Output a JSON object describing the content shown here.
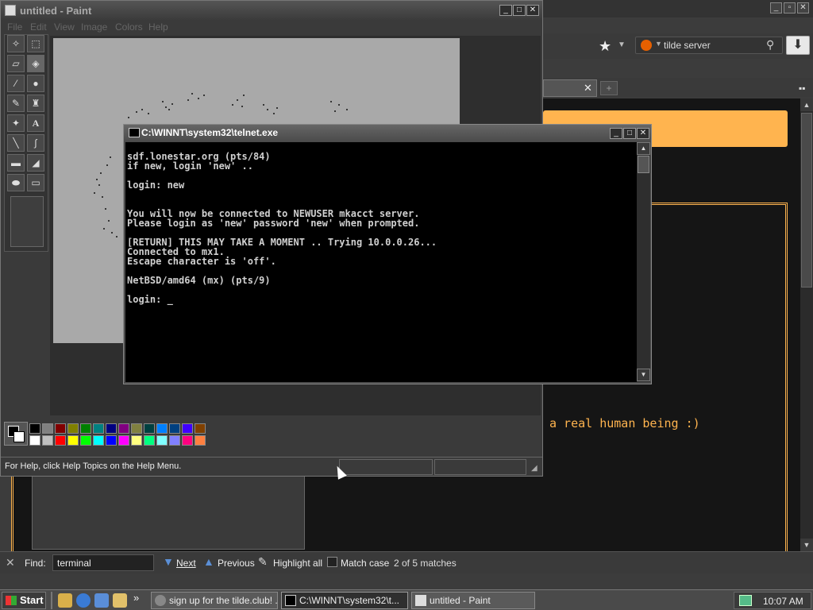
{
  "browser": {
    "search": {
      "value": "tilde server"
    },
    "human_text": "a real human being :)"
  },
  "findbar": {
    "label": "Find:",
    "value": "terminal",
    "next": "Next",
    "previous": "Previous",
    "highlight": "Highlight all",
    "matchcase": "Match case",
    "count": "2 of 5 matches"
  },
  "paint": {
    "title": "untitled - Paint",
    "menus": [
      "File",
      "Edit",
      "View",
      "Image",
      "Colors",
      "Help"
    ],
    "status": "For Help, click Help Topics on the Help Menu.",
    "palette_top": [
      "#000000",
      "#808080",
      "#800000",
      "#808000",
      "#008000",
      "#008080",
      "#000080",
      "#800080",
      "#808040",
      "#004040",
      "#0080ff",
      "#004080",
      "#4000ff",
      "#804000"
    ],
    "palette_bottom": [
      "#ffffff",
      "#c0c0c0",
      "#ff0000",
      "#ffff00",
      "#00ff00",
      "#00ffff",
      "#0000ff",
      "#ff00ff",
      "#ffff80",
      "#00ff80",
      "#80ffff",
      "#8080ff",
      "#ff0080",
      "#ff8040"
    ]
  },
  "telnet": {
    "title": "C:\\WINNT\\system32\\telnet.exe",
    "output": "sdf.lonestar.org (pts/84)\nif new, login 'new' ..\n\nlogin: new\n\n\nYou will now be connected to NEWUSER mkacct server.\nPlease login as 'new' password 'new' when prompted.\n\n[RETURN] THIS MAY TAKE A MOMENT .. Trying 10.0.0.26...\nConnected to mx1.\nEscape character is 'off'.\n\nNetBSD/amd64 (mx) (pts/9)\n\nlogin: _"
  },
  "taskbar": {
    "start": "Start",
    "more": "»",
    "buttons": [
      {
        "label": "sign up for the tilde.club! ..."
      },
      {
        "label": "C:\\WINNT\\system32\\t..."
      },
      {
        "label": "untitled - Paint"
      }
    ],
    "clock": "10:07 AM"
  }
}
